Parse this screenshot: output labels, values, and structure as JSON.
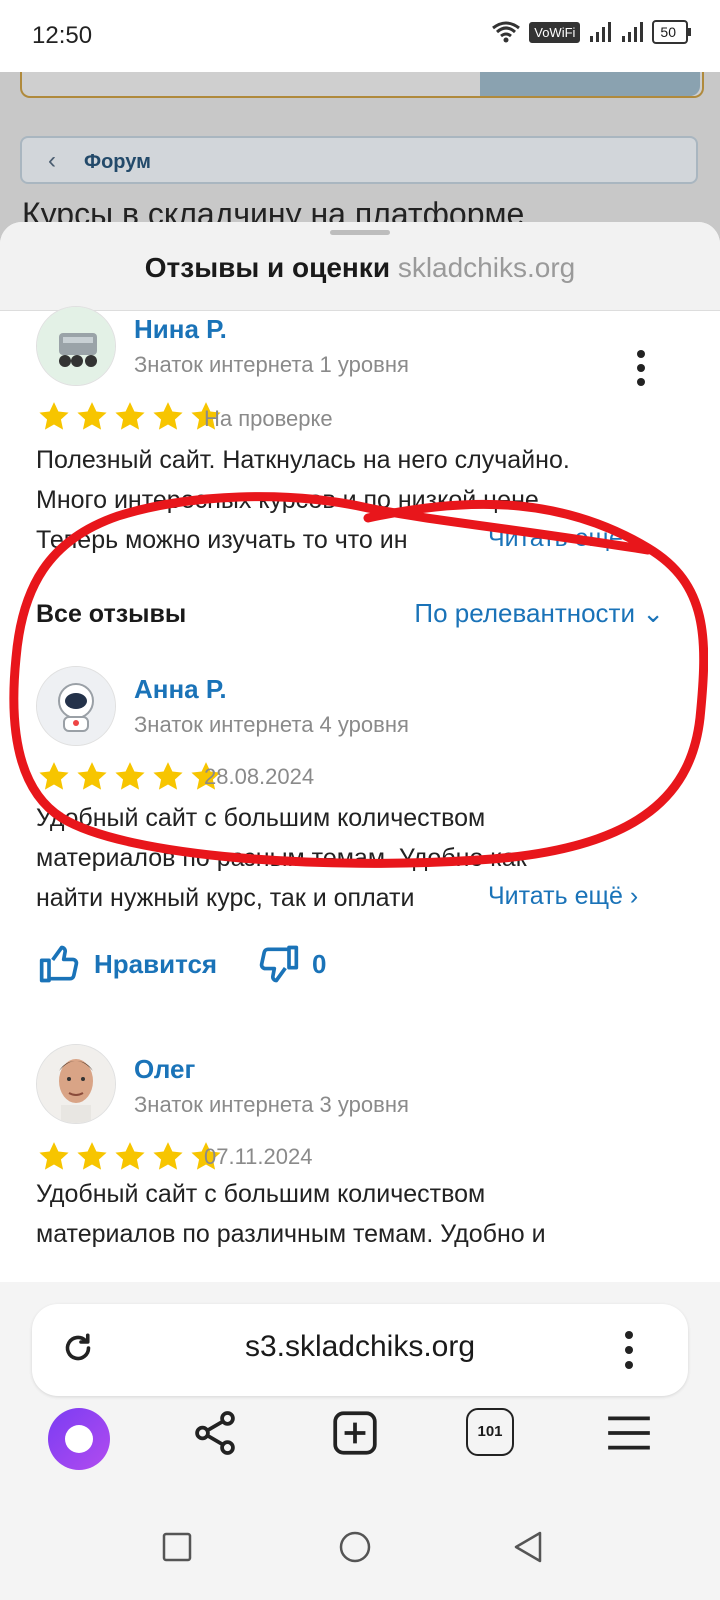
{
  "status_bar": {
    "time": "12:50",
    "vowifi": "VoWiFi",
    "battery": "50"
  },
  "background_page": {
    "forum_label": "Форум",
    "title": "Курсы в складчину на платформе"
  },
  "sheet": {
    "title_bold": "Отзывы и оценки",
    "title_site": "skladchiks.org"
  },
  "featured_review": {
    "name": "Нина Р.",
    "level": "Знаток интернета 1 уровня",
    "rating": 5,
    "status": "На проверке",
    "lines": [
      "Полезный сайт. Наткнулась на него случайно.",
      "Много интересных курсов и по низкой цене.",
      "Теперь можно изучать то что ин"
    ],
    "read_more": "Читать ещё ›"
  },
  "list_header": {
    "label": "Все отзывы",
    "sort": "По релевантности ⌄"
  },
  "reviews": [
    {
      "name": "Анна Р.",
      "level": "Знаток интернета 4 уровня",
      "rating": 5,
      "date": "28.08.2024",
      "lines": [
        "Удобный сайт с большим количеством",
        "материалов по разным темам. Удобно как",
        "найти нужный курс, так и оплати"
      ],
      "read_more": "Читать ещё ›",
      "like_label": "Нравится",
      "dislike_count": "0"
    },
    {
      "name": "Олег",
      "level": "Знаток интернета 3 уровня",
      "rating": 5,
      "date": "07.11.2024",
      "lines": [
        "Удобный сайт с большим количеством",
        "материалов по различным темам. Удобно и"
      ]
    }
  ],
  "browser": {
    "url": "s3.skladchiks.org",
    "tabs_count": "101"
  },
  "colors": {
    "link": "#1a73b8",
    "star": "#f7c500",
    "highlight": "#e8161b"
  }
}
